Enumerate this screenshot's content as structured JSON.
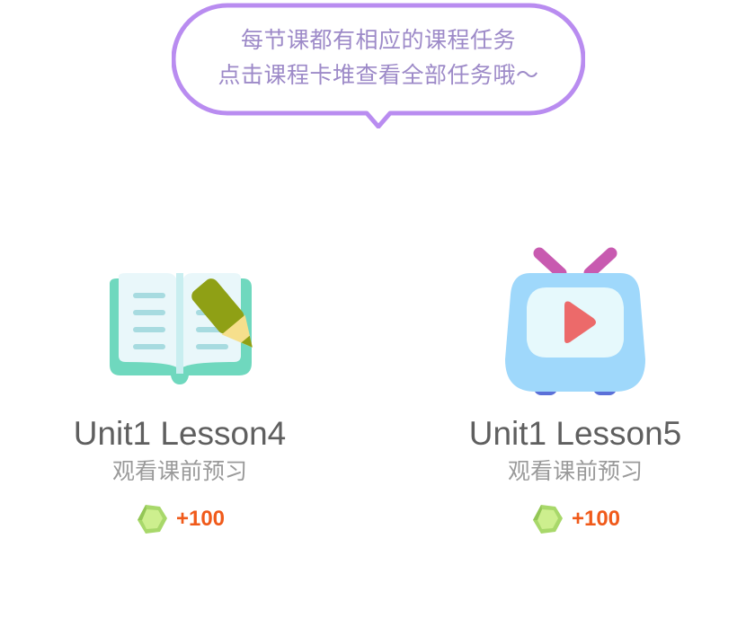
{
  "tooltip": {
    "line1": "每节课都有相应的课程任务",
    "line2": "点击课程卡堆查看全部任务哦～",
    "border_color": "#b98cf0",
    "text_color": "#9d8ac8"
  },
  "cards": [
    {
      "icon": "book-pencil-icon",
      "title": "Unit1 Lesson4",
      "subtitle": "观看课前预习",
      "reward_icon": "gem-icon",
      "reward": "+100"
    },
    {
      "icon": "tv-play-icon",
      "title": "Unit1 Lesson5",
      "subtitle": "观看课前预习",
      "reward_icon": "gem-icon",
      "reward": "+100"
    }
  ],
  "colors": {
    "title": "#5f5f5f",
    "subtitle": "#9a9a9a",
    "reward": "#f05a1a"
  }
}
